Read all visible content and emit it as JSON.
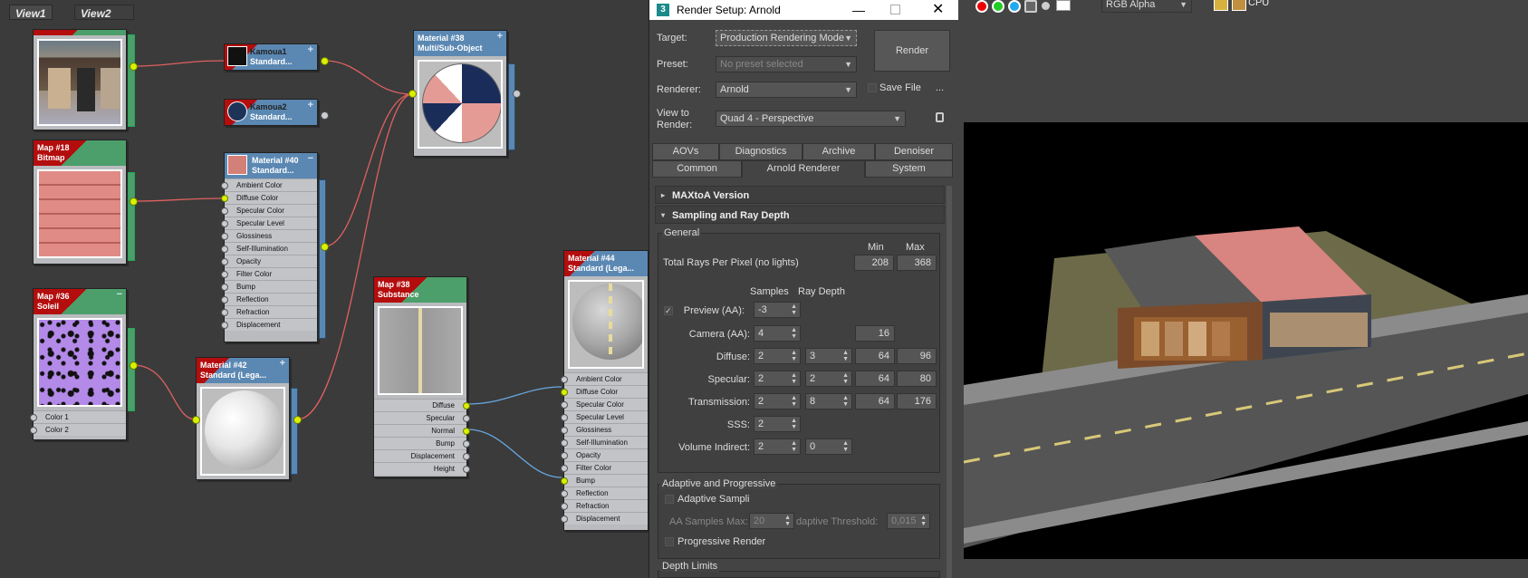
{
  "editor": {
    "tabs": [
      "View1",
      "View2"
    ],
    "nodes": {
      "img_top": {
        "title": "",
        "subtitle": ""
      },
      "kamoua1": {
        "title": "Kamoua1",
        "subtitle": "Standard..."
      },
      "kamoua2": {
        "title": "Kamoua2",
        "subtitle": "Standard..."
      },
      "mat38": {
        "title": "Material #38",
        "subtitle": "Multi/Sub-Object"
      },
      "map18": {
        "title": "Map #18",
        "subtitle": "Bitmap"
      },
      "mat40": {
        "title": "Material #40",
        "subtitle": "Standard...",
        "slots": [
          "Ambient Color",
          "Diffuse Color",
          "Specular Color",
          "Specular Level",
          "Glossiness",
          "Self-Illumination",
          "Opacity",
          "Filter Color",
          "Bump",
          "Reflection",
          "Refraction",
          "Displacement"
        ]
      },
      "map36": {
        "title": "Map #36",
        "subtitle": "Soleil",
        "slots": [
          "Color 1",
          "Color 2"
        ]
      },
      "mat42": {
        "title": "Material #42",
        "subtitle": "Standard (Lega..."
      },
      "map38": {
        "title": "Map #38",
        "subtitle": "Substance",
        "slots": [
          "Diffuse",
          "Specular",
          "Normal",
          "Bump",
          "Displacement",
          "Height"
        ]
      },
      "mat44": {
        "title": "Material #44",
        "subtitle": "Standard (Lega...",
        "slots": [
          "Ambient Color",
          "Diffuse Color",
          "Specular Color",
          "Specular Level",
          "Glossiness",
          "Self-Illumination",
          "Opacity",
          "Filter Color",
          "Bump",
          "Reflection",
          "Refraction",
          "Displacement"
        ]
      }
    }
  },
  "dialog": {
    "title": "Render Setup: Arnold",
    "target_label": "Target:",
    "target_value": "Production Rendering Mode",
    "preset_label": "Preset:",
    "preset_value": "No preset selected",
    "renderer_label": "Renderer:",
    "renderer_value": "Arnold",
    "save_file": "Save File",
    "more": "...",
    "view_label": "View to Render:",
    "view_value": "Quad 4 - Perspective",
    "render_button": "Render",
    "tabs_row1": [
      "AOVs",
      "Diagnostics",
      "Archive",
      "Denoiser"
    ],
    "tabs_row2": [
      "Common",
      "Arnold Renderer",
      "System"
    ],
    "rollout_version": "MAXtoA Version",
    "rollout_sampling": "Sampling and Ray Depth",
    "general": "General",
    "min": "Min",
    "max": "Max",
    "total_rays": "Total Rays Per Pixel (no lights)",
    "total_min": "208",
    "total_max": "368",
    "samples": "Samples",
    "ray_depth": "Ray Depth",
    "rows": [
      {
        "label": "Preview (AA):",
        "samples": "-3",
        "depth": "",
        "min": "",
        "max": ""
      },
      {
        "label": "Camera (AA):",
        "samples": "4",
        "depth": "",
        "min": "16",
        "max": ""
      },
      {
        "label": "Diffuse:",
        "samples": "2",
        "depth": "3",
        "min": "64",
        "max": "96"
      },
      {
        "label": "Specular:",
        "samples": "2",
        "depth": "2",
        "min": "64",
        "max": "80"
      },
      {
        "label": "Transmission:",
        "samples": "2",
        "depth": "8",
        "min": "64",
        "max": "176"
      },
      {
        "label": "SSS:",
        "samples": "2",
        "depth": "",
        "min": "",
        "max": ""
      },
      {
        "label": "Volume Indirect:",
        "samples": "2",
        "depth": "0",
        "min": "",
        "max": ""
      }
    ],
    "adaptive_group": "Adaptive and Progressive",
    "adaptive_sampling": "Adaptive Sampli",
    "aa_samples_max_label": "AA Samples Max:",
    "aa_samples_max": "20",
    "adaptive_threshold_label": "daptive Threshold:",
    "adaptive_threshold": "0,015",
    "progressive_render": "Progressive Render",
    "depth_limits": "Depth Limits"
  },
  "framebuffer": {
    "channel": "RGB Alpha",
    "cpu": "CPU"
  }
}
